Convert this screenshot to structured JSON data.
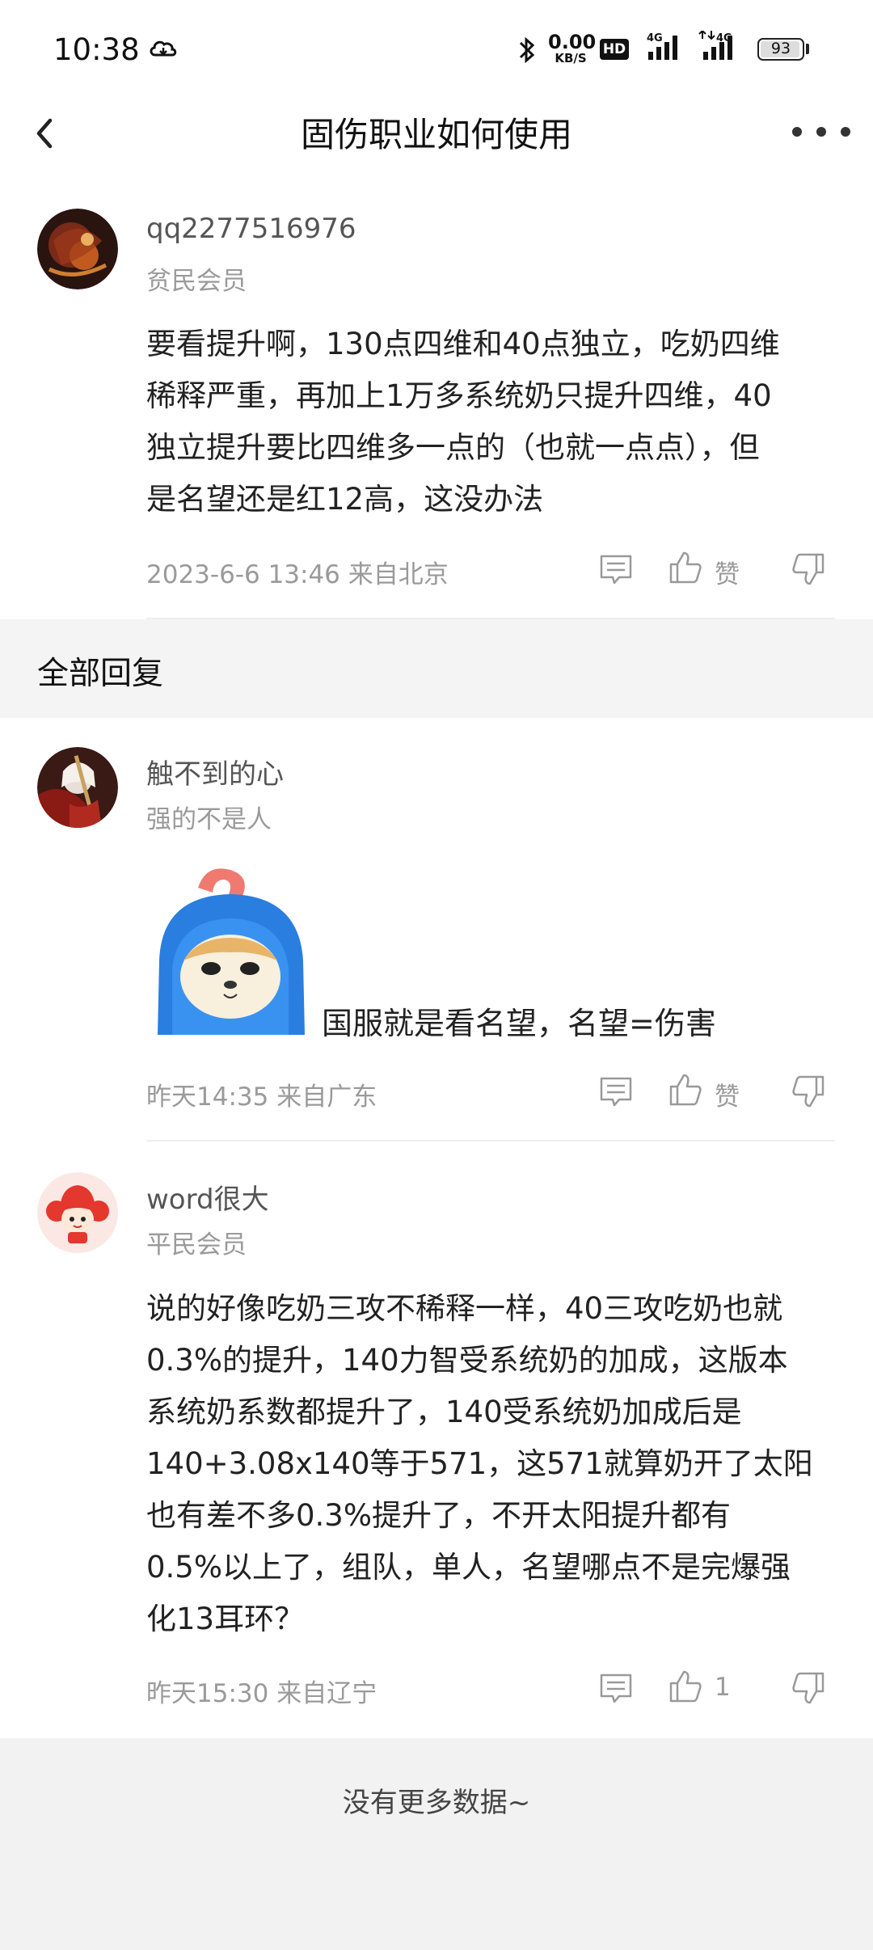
{
  "status_bar": {
    "time": "10:38",
    "net_speed_value": "0.00",
    "net_speed_unit": "KB/S",
    "hd_label": "HD",
    "sig1_label": "4G",
    "sig2_label": "4G",
    "battery": "93"
  },
  "nav": {
    "title": "固伤职业如何使用"
  },
  "main_post": {
    "username": "qq2277516976",
    "member_title": "贫民会员",
    "content_lines": [
      "要看提升啊，130点四维和40点独立，吃奶四维",
      "稀释严重，再加上1万多系统奶只提升四维，40",
      "独立提升要比四维多一点的（也就一点点），但",
      "是名望还是红12高，这没办法"
    ],
    "meta": "2023-6-6 13:46  来自北京",
    "like_label": "赞"
  },
  "section": {
    "title": "全部回复"
  },
  "replies": [
    {
      "username": "触不到的心",
      "subtitle": "强的不是人",
      "text": "国服就是看名望，名望=伤害",
      "meta": "昨天14:35 来自广东",
      "like_label": "赞"
    },
    {
      "username": "word很大",
      "subtitle": "平民会员",
      "content_lines": [
        "说的好像吃奶三攻不稀释一样，40三攻吃奶也就",
        "0.3%的提升，140力智受系统奶的加成，这版本",
        "系统奶系数都提升了，140受系统奶加成后是",
        "140+3.08x140等于571，这571就算奶开了太阳",
        "也有差不多0.3%提升了，不开太阳提升都有",
        "0.5%以上了，组队，单人，名望哪点不是完爆强",
        "化13耳环？"
      ],
      "meta": "昨天15:30 来自辽宁",
      "like_label": "1"
    }
  ],
  "footer": {
    "text": "没有更多数据~"
  }
}
